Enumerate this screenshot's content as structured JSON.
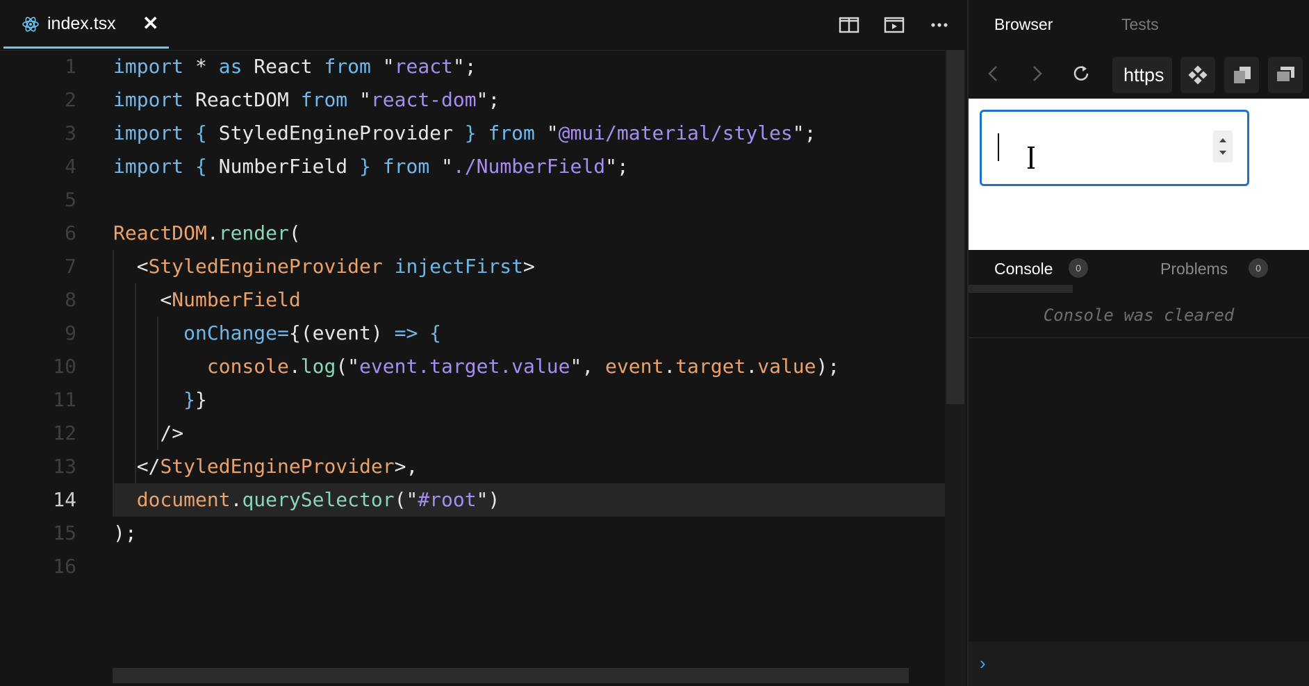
{
  "editor": {
    "tab": {
      "filename": "index.tsx",
      "close": "✕",
      "icon": "react-icon"
    },
    "toolbar": {
      "icons": [
        "split-editor-icon",
        "preview-icon",
        "more-icon"
      ]
    },
    "current_line": 14,
    "lines": [
      {
        "n": "1",
        "tokens": [
          [
            "kw",
            "import"
          ],
          [
            "pl",
            " * "
          ],
          [
            "kw",
            "as"
          ],
          [
            "pl",
            " React "
          ],
          [
            "kw",
            "from"
          ],
          [
            "pl",
            " \""
          ],
          [
            "str",
            "react"
          ],
          [
            "pl",
            "\";"
          ]
        ]
      },
      {
        "n": "2",
        "tokens": [
          [
            "kw",
            "import"
          ],
          [
            "pl",
            " ReactDOM "
          ],
          [
            "kw",
            "from"
          ],
          [
            "pl",
            " \""
          ],
          [
            "str",
            "react-dom"
          ],
          [
            "pl",
            "\";"
          ]
        ]
      },
      {
        "n": "3",
        "tokens": [
          [
            "kw",
            "import"
          ],
          [
            "pl",
            " "
          ],
          [
            "at",
            "{"
          ],
          [
            "pl",
            " StyledEngineProvider "
          ],
          [
            "at",
            "}"
          ],
          [
            "pl",
            " "
          ],
          [
            "kw",
            "from"
          ],
          [
            "pl",
            " \""
          ],
          [
            "str",
            "@mui/material/styles"
          ],
          [
            "pl",
            "\";"
          ]
        ]
      },
      {
        "n": "4",
        "tokens": [
          [
            "kw",
            "import"
          ],
          [
            "pl",
            " "
          ],
          [
            "at",
            "{"
          ],
          [
            "pl",
            " NumberField "
          ],
          [
            "at",
            "}"
          ],
          [
            "pl",
            " "
          ],
          [
            "kw",
            "from"
          ],
          [
            "pl",
            " \""
          ],
          [
            "str",
            "./NumberField"
          ],
          [
            "pl",
            "\";"
          ]
        ]
      },
      {
        "n": "5",
        "tokens": []
      },
      {
        "n": "6",
        "tokens": [
          [
            "fn",
            "ReactDOM"
          ],
          [
            "pl",
            "."
          ],
          [
            "mt",
            "render"
          ],
          [
            "pl",
            "("
          ]
        ]
      },
      {
        "n": "7",
        "tokens": [
          [
            "pl",
            "  <"
          ],
          [
            "fn",
            "StyledEngineProvider"
          ],
          [
            "pl",
            " "
          ],
          [
            "at",
            "injectFirst"
          ],
          [
            "pl",
            ">"
          ]
        ]
      },
      {
        "n": "8",
        "tokens": [
          [
            "pl",
            "    <"
          ],
          [
            "fn",
            "NumberField"
          ]
        ]
      },
      {
        "n": "9",
        "tokens": [
          [
            "pl",
            "      "
          ],
          [
            "at",
            "onChange"
          ],
          [
            "kw",
            "="
          ],
          [
            "pl",
            "{(event) "
          ],
          [
            "kw",
            "=>"
          ],
          [
            "pl",
            " "
          ],
          [
            "at",
            "{"
          ]
        ]
      },
      {
        "n": "10",
        "tokens": [
          [
            "pl",
            "        "
          ],
          [
            "fn",
            "console"
          ],
          [
            "pl",
            "."
          ],
          [
            "mt",
            "log"
          ],
          [
            "pl",
            "(\""
          ],
          [
            "str",
            "event.target.value"
          ],
          [
            "pl",
            "\", "
          ],
          [
            "fn",
            "event"
          ],
          [
            "pl",
            "."
          ],
          [
            "fn",
            "target"
          ],
          [
            "pl",
            "."
          ],
          [
            "fn",
            "value"
          ],
          [
            "pl",
            ");"
          ]
        ]
      },
      {
        "n": "11",
        "tokens": [
          [
            "pl",
            "      "
          ],
          [
            "at",
            "}"
          ],
          [
            "pl",
            "}"
          ]
        ]
      },
      {
        "n": "12",
        "tokens": [
          [
            "pl",
            "    />"
          ]
        ]
      },
      {
        "n": "13",
        "tokens": [
          [
            "pl",
            "  </"
          ],
          [
            "fn",
            "StyledEngineProvider"
          ],
          [
            "pl",
            ">,"
          ]
        ]
      },
      {
        "n": "14",
        "tokens": [
          [
            "pl",
            "  "
          ],
          [
            "fn",
            "document"
          ],
          [
            "pl",
            "."
          ],
          [
            "mt",
            "querySelector"
          ],
          [
            "pl",
            "(\""
          ],
          [
            "str",
            "#root"
          ],
          [
            "pl",
            "\")"
          ]
        ]
      },
      {
        "n": "15",
        "tokens": [
          [
            "pl",
            ");"
          ]
        ]
      },
      {
        "n": "16",
        "tokens": []
      }
    ]
  },
  "preview": {
    "tabs": [
      "Browser",
      "Tests"
    ],
    "active_tab": "Browser",
    "nav_icons": [
      "back-icon",
      "forward-icon",
      "refresh-icon"
    ],
    "url": "https",
    "url_buttons": [
      "codesandbox-icon",
      "copy-icon",
      "open-window-icon"
    ],
    "number_field": {
      "value": "",
      "cursor": "text-cursor-icon",
      "stepper": "stepper-icon"
    }
  },
  "console": {
    "tabs": [
      {
        "label": "Console",
        "count": "0"
      },
      {
        "label": "Problems",
        "count": "0"
      }
    ],
    "message": "Console was cleared",
    "prompt": "›"
  },
  "colors": {
    "keyword": "#71b8ec",
    "string": "#a58ef0",
    "identifier": "#eba26a",
    "method": "#8ad6b6",
    "attribute": "#6cb7e8",
    "accent": "#6cc7f6",
    "focus": "#1f6fd0"
  }
}
